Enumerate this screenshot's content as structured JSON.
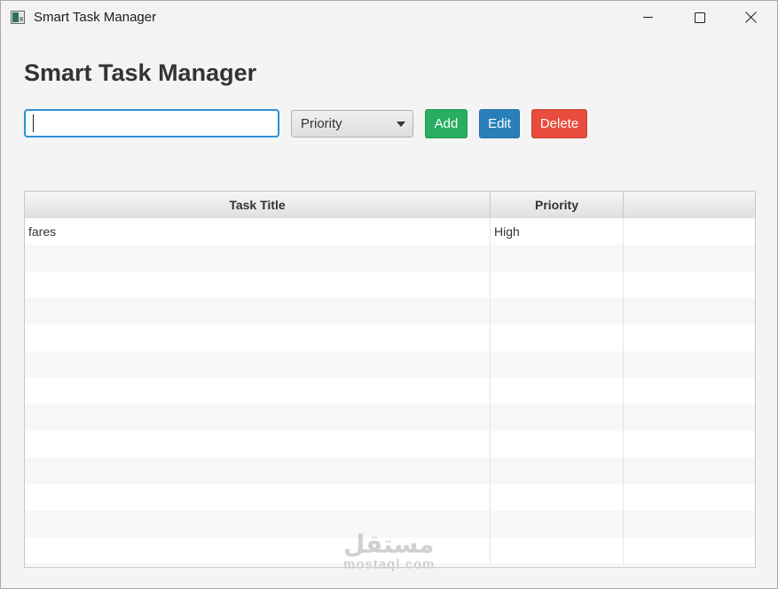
{
  "window": {
    "title": "Smart Task Manager"
  },
  "header": {
    "heading": "Smart Task Manager"
  },
  "form": {
    "task_input_value": "",
    "priority_selected": "Priority",
    "add_label": "Add",
    "edit_label": "Edit",
    "delete_label": "Delete"
  },
  "table": {
    "columns": [
      "Task Title",
      "Priority",
      ""
    ],
    "rows": [
      {
        "title": "fares",
        "priority": "High",
        "extra": ""
      }
    ]
  },
  "watermark": {
    "arabic": "مستقل",
    "latin": "mostaql.com"
  },
  "colors": {
    "add": "#27ae60",
    "edit": "#2980b9",
    "delete": "#e74c3c",
    "focus": "#2b93d6"
  },
  "icons": {
    "app": "app-icon",
    "minimize": "minimize-icon",
    "maximize": "maximize-icon",
    "close": "close-icon",
    "dropdown": "chevron-down-icon"
  }
}
